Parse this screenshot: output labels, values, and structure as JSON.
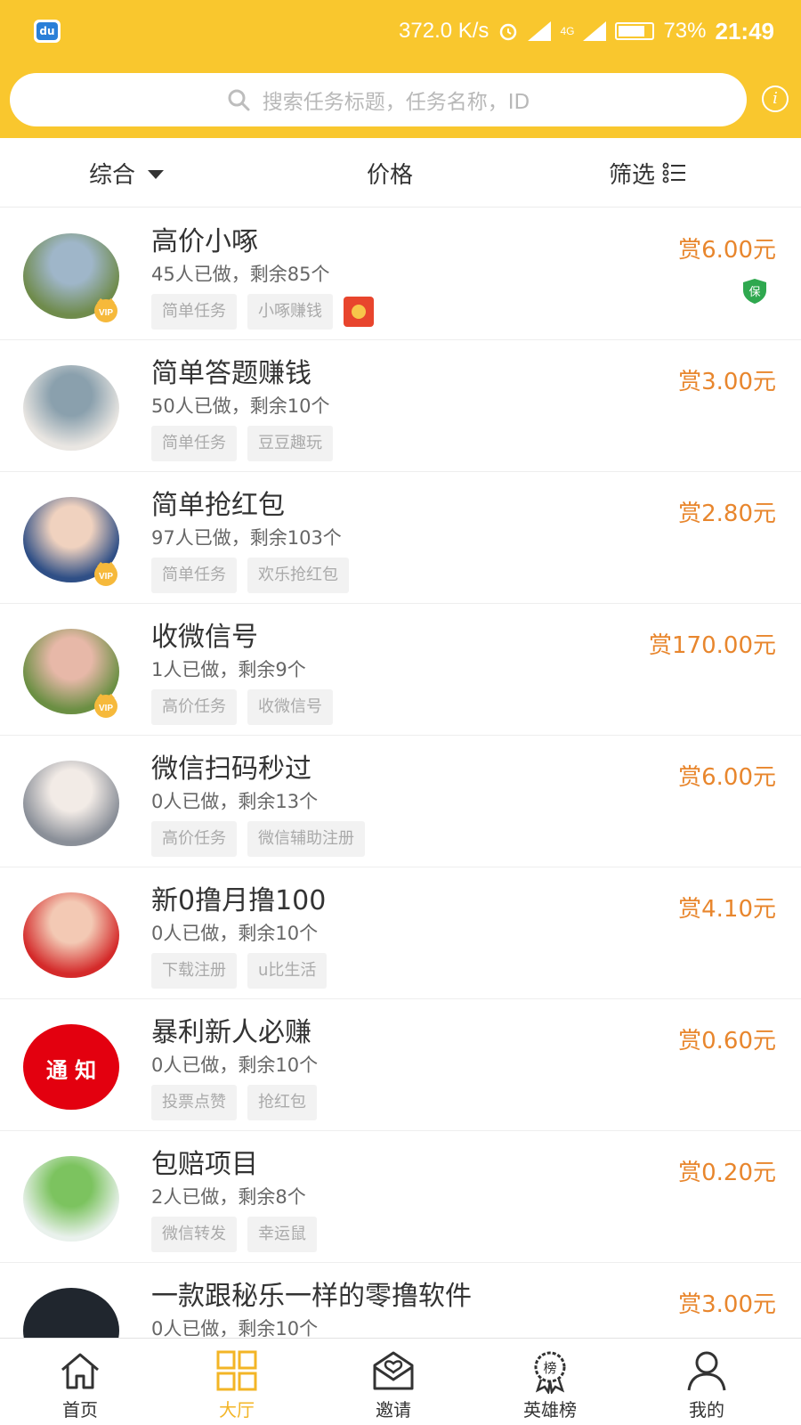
{
  "status": {
    "app_icon": "du",
    "net_speed": "372.0 K/s",
    "alarm": "1X",
    "network": "4G",
    "battery": "73%",
    "time": "21:49"
  },
  "search": {
    "placeholder": "搜索任务标题，任务名称，ID",
    "info": "i"
  },
  "filters": {
    "comprehensive": "综合",
    "price": "价格",
    "filter": "筛选"
  },
  "tasks": [
    {
      "title": "高价小啄",
      "stats": "45人已做，剩余85个",
      "tags": [
        "简单任务",
        "小啄赚钱"
      ],
      "reward": "赏6.00元",
      "vip": true,
      "red_packet": true,
      "guarantee": "保",
      "avatar_colors": [
        "#6f8b4c",
        "#9fb6c9"
      ]
    },
    {
      "title": "简单答题赚钱",
      "stats": "50人已做，剩余10个",
      "tags": [
        "简单任务",
        "豆豆趣玩"
      ],
      "reward": "赏3.00元",
      "vip": false,
      "avatar_colors": [
        "#e9e6e2",
        "#8aa0ad"
      ]
    },
    {
      "title": "简单抢红包",
      "stats": "97人已做，剩余103个",
      "tags": [
        "简单任务",
        "欢乐抢红包"
      ],
      "reward": "赏2.80元",
      "vip": true,
      "avatar_colors": [
        "#2f4f86",
        "#f0d2bf"
      ]
    },
    {
      "title": "收微信号",
      "stats": "1人已做，剩余9个",
      "tags": [
        "高价任务",
        "收微信号"
      ],
      "reward": "赏170.00元",
      "vip": true,
      "avatar_colors": [
        "#6b8f43",
        "#e7b8a8"
      ]
    },
    {
      "title": "微信扫码秒过",
      "stats": "0人已做，剩余13个",
      "tags": [
        "高价任务",
        "微信辅助注册"
      ],
      "reward": "赏6.00元",
      "vip": false,
      "avatar_colors": [
        "#8a8f98",
        "#f2ebe6"
      ]
    },
    {
      "title": "新0撸月撸100",
      "stats": "0人已做，剩余10个",
      "tags": [
        "下载注册",
        "u比生活"
      ],
      "reward": "赏4.10元",
      "vip": false,
      "avatar_colors": [
        "#d42a2a",
        "#f3c9b4"
      ]
    },
    {
      "title": "暴利新人必赚",
      "stats": "0人已做，剩余10个",
      "tags": [
        "投票点赞",
        "抢红包"
      ],
      "reward": "赏0.60元",
      "vip": false,
      "avatar_text": "通 知",
      "avatar_colors": [
        "#e3000f",
        "#e3000f"
      ]
    },
    {
      "title": "包赔项目",
      "stats": "2人已做，剩余8个",
      "tags": [
        "微信转发",
        "幸运鼠"
      ],
      "reward": "赏0.20元",
      "vip": false,
      "avatar_colors": [
        "#e9f1ec",
        "#7cc35f"
      ]
    },
    {
      "title": "一款跟秘乐一样的零撸软件",
      "stats": "0人已做，剩余10个",
      "tags": [],
      "reward": "赏3.00元",
      "vip": false,
      "avatar_colors": [
        "#20262e",
        "#20262e"
      ]
    }
  ],
  "nav": [
    {
      "label": "首页",
      "icon": "home-icon",
      "active": false
    },
    {
      "label": "大厅",
      "icon": "grid-icon",
      "active": true
    },
    {
      "label": "邀请",
      "icon": "envelope-heart-icon",
      "active": false
    },
    {
      "label": "英雄榜",
      "icon": "ranking-badge-icon",
      "active": false
    },
    {
      "label": "我的",
      "icon": "user-icon",
      "active": false
    }
  ],
  "colors": {
    "header": "#f9c72e",
    "reward": "#e8862d",
    "active_nav": "#f3b526",
    "tag_bg": "#f2f2f2"
  },
  "vip_label": "VIP"
}
